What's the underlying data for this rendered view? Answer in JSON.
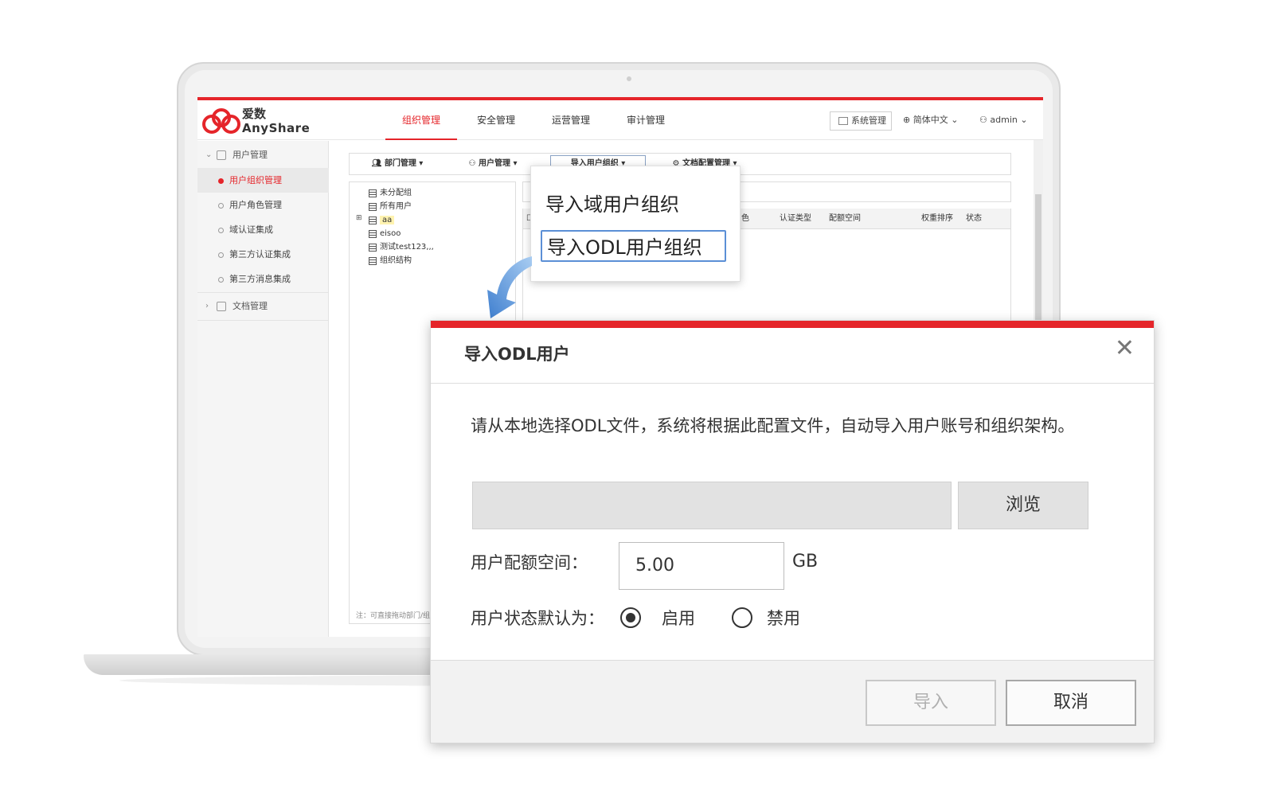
{
  "app": {
    "logo_cn": "爱数",
    "logo_en": "AnyShare",
    "nav": [
      "组织管理",
      "安全管理",
      "运营管理",
      "审计管理"
    ],
    "active_nav": 0,
    "system_btn": "系统管理",
    "language": "简体中文",
    "user": "admin"
  },
  "sidebar": {
    "group_user": "用户管理",
    "items": [
      "用户组织管理",
      "用户角色管理",
      "域认证集成",
      "第三方认证集成",
      "第三方消息集成"
    ],
    "group_doc": "文档管理"
  },
  "toolbar": [
    "部门管理",
    "用户管理",
    "导入用户组织",
    "文档配置管理"
  ],
  "tree": {
    "nodes": [
      "未分配组",
      "所有用户",
      "aa",
      "eisoo",
      "测试test123,,,",
      "组织结构"
    ],
    "note": "注：可直接拖动部门/组"
  },
  "grid_headers": [
    "色",
    "认证类型",
    "配额空间",
    "权重排序",
    "状态"
  ],
  "dropdown": {
    "items": [
      "导入域用户组织",
      "导入ODL用户组织"
    ],
    "selected": 1
  },
  "dialog": {
    "title": "导入ODL用户",
    "description": "请从本地选择ODL文件，系统将根据此配置文件，自动导入用户账号和组织架构。",
    "browse_label": "浏览",
    "quota_label": "用户配额空间：",
    "quota_value": "5.00",
    "quota_unit": "GB",
    "status_label": "用户状态默认为：",
    "status_options": [
      "启用",
      "禁用"
    ],
    "status_selected": "启用",
    "import_label": "导入",
    "cancel_label": "取消"
  },
  "colors": {
    "brand": "#e5252a",
    "selection_border": "#5b8fd6",
    "arrow": "#6aa2dc"
  }
}
